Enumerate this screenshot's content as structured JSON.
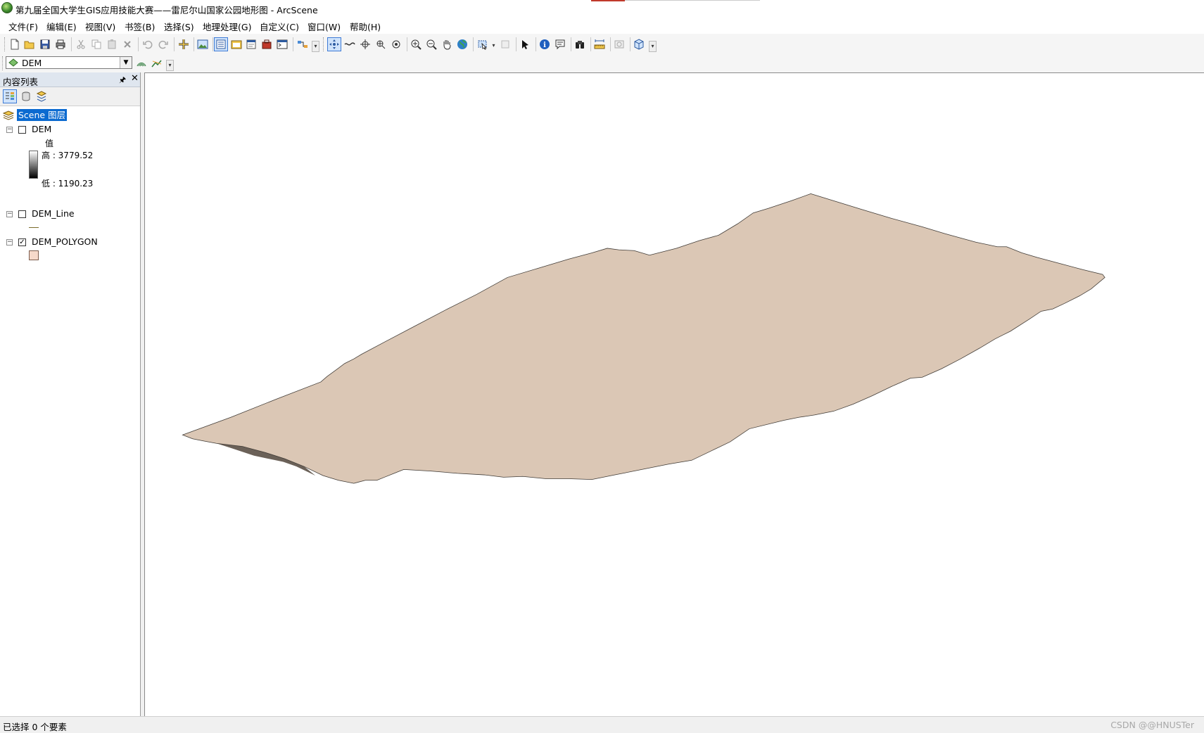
{
  "window": {
    "title": "第九届全国大学生GIS应用技能大赛——雷尼尔山国家公园地形图 - ArcScene"
  },
  "menu": {
    "items": [
      "文件(F)",
      "编辑(E)",
      "视图(V)",
      "书签(B)",
      "选择(S)",
      "地理处理(G)",
      "自定义(C)",
      "窗口(W)",
      "帮助(H)"
    ]
  },
  "layer_selector": {
    "value": "DEM"
  },
  "toc": {
    "title": "内容列表",
    "scene_label": "Scene 图层",
    "layers": [
      {
        "name": "DEM",
        "checked": false,
        "legend_title": "值",
        "high_label": "高 : 3779.52",
        "low_label": "低 : 1190.23"
      },
      {
        "name": "DEM_Line",
        "checked": false
      },
      {
        "name": "DEM_POLYGON",
        "checked": true,
        "fill_color": "#f6d9ca"
      }
    ]
  },
  "scene": {
    "surface_color": "#dbc7b5",
    "shadow_color": "#6b6158"
  },
  "status": {
    "selection_text": "已选择 0 个要素"
  },
  "watermark": "CSDN @@HNUSTer",
  "colors": {
    "selection_highlight": "#0b6ad0",
    "panel_header": "#dfe6ef"
  }
}
